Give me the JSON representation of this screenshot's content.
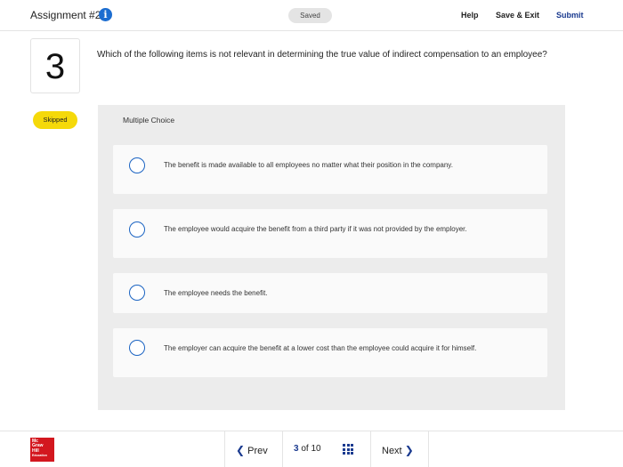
{
  "header": {
    "title": "Assignment #2",
    "info_icon": "info-icon",
    "saved_label": "Saved",
    "help_label": "Help",
    "save_exit_label": "Save & Exit",
    "submit_label": "Submit"
  },
  "question": {
    "number": "3",
    "text": "Which of the following items is not relevant in determining the true value of indirect compensation to an employee?",
    "status": "Skipped",
    "type_label": "Multiple Choice",
    "options": [
      {
        "text": "The benefit is made available to all employees no matter what their position in the company."
      },
      {
        "text": "The employee would acquire the benefit from a third party if it was not provided by the employer."
      },
      {
        "text": "The employee needs the benefit."
      },
      {
        "text": "The employer can acquire the benefit at a lower cost than the employee could acquire it for himself."
      }
    ]
  },
  "footer": {
    "logo_lines": [
      "Mc",
      "Graw",
      "Hill",
      "Education"
    ],
    "prev_label": "Prev",
    "next_label": "Next",
    "current_page": "3",
    "of_label": "of",
    "total_pages": "10",
    "grid_icon": "grid-icon"
  },
  "colors": {
    "accent": "#1a3a8f",
    "radio": "#1a63c2",
    "skipped_badge": "#f5d90a",
    "logo": "#d3171f"
  }
}
